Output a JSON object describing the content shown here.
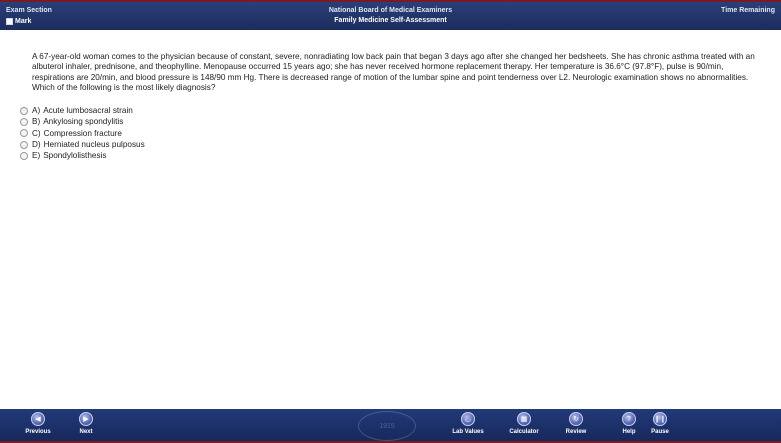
{
  "header": {
    "section_label": "Exam Section",
    "mark_label": "Mark",
    "org_name": "National Board of Medical Examiners",
    "exam_title": "Family Medicine Self-Assessment",
    "time_label": "Time Remaining"
  },
  "question": {
    "text": "A 67-year-old woman comes to the physician because of constant, severe, nonradiating low back pain that began 3 days ago after she changed her bedsheets. She has chronic asthma treated with an albuterol inhaler, prednisone, and theophylline. Menopause occurred 15 years ago; she has never received hormone replacement therapy. Her temperature is 36.6°C (97.8°F), pulse is 90/min, respirations are 20/min, and blood pressure is 148/90 mm Hg. There is decreased range of motion of the lumbar spine and point tenderness over L2. Neurologic examination shows no abnormalities. Which of the following is the most likely diagnosis?"
  },
  "answers": [
    {
      "letter": "A)",
      "text": "Acute lumbosacral strain"
    },
    {
      "letter": "B)",
      "text": "Ankylosing spondylitis"
    },
    {
      "letter": "C)",
      "text": "Compression fracture"
    },
    {
      "letter": "D)",
      "text": "Herniated nucleus pulposus"
    },
    {
      "letter": "E)",
      "text": "Spondylolisthesis"
    }
  ],
  "footer": {
    "previous": "Previous",
    "next": "Next",
    "lab_values": "Lab Values",
    "calculator": "Calculator",
    "review": "Review",
    "help": "Help",
    "pause": "Pause",
    "seal_text": "1915"
  },
  "colors": {
    "bar": "#1c2d5e",
    "accent": "#7a1a24"
  }
}
